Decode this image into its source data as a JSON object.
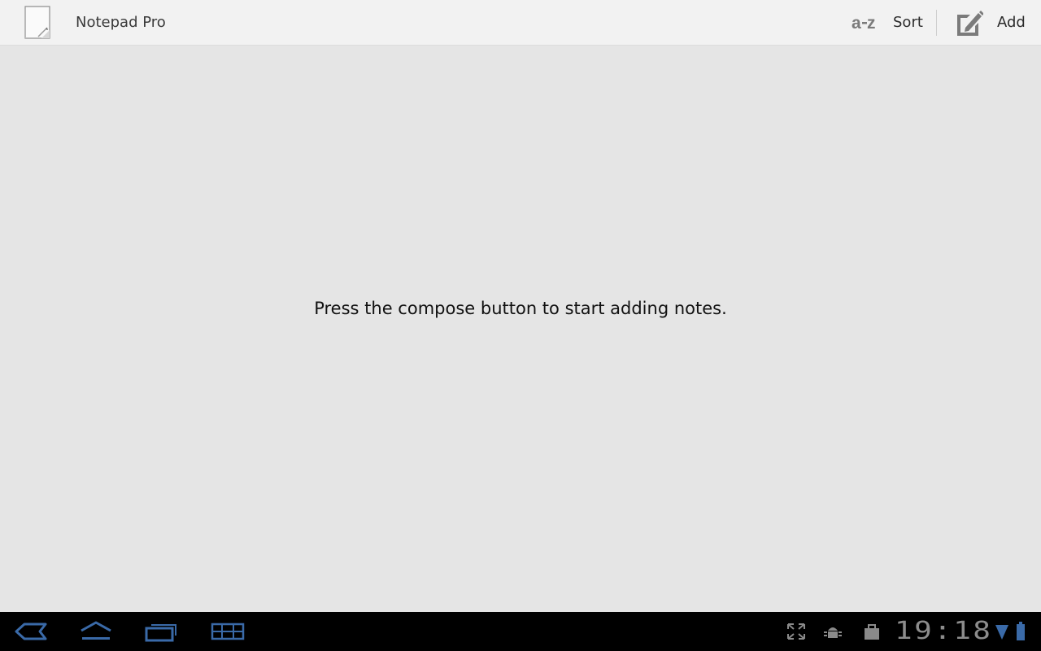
{
  "app": {
    "title": "Notepad Pro",
    "icon": "notepad-app-icon"
  },
  "actions": {
    "sort": {
      "label": "Sort",
      "icon": "a-z-sort-icon"
    },
    "add": {
      "label": "Add",
      "icon": "compose-icon"
    }
  },
  "content": {
    "empty_message": "Press the compose button to start adding notes."
  },
  "system_bar": {
    "nav": [
      {
        "name": "back-icon"
      },
      {
        "name": "home-icon"
      },
      {
        "name": "recent-apps-icon"
      },
      {
        "name": "screenshot-grid-icon"
      }
    ],
    "status_icons": [
      "expand-icon",
      "android-debug-icon",
      "shopping-bag-icon"
    ],
    "clock": "19:18",
    "wifi": "wifi-signal-icon",
    "battery": "battery-icon"
  },
  "colors": {
    "action_bar_bg": "#f2f2f2",
    "content_bg": "#e5e5e5",
    "system_bar_bg": "#000000",
    "system_icon": "#3a6aa8"
  }
}
